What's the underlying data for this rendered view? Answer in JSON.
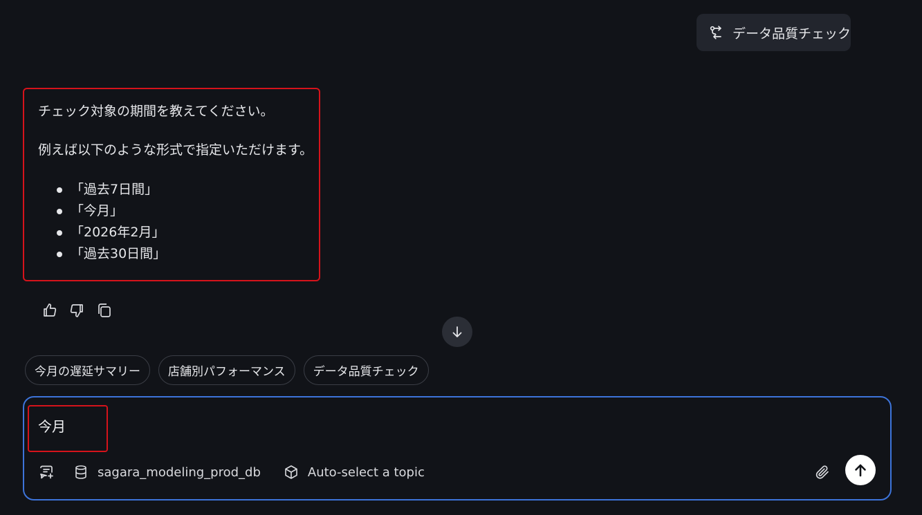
{
  "user_message": {
    "icon": "workflow-icon",
    "text": "データ品質チェック"
  },
  "assistant_message": {
    "paragraph1": "チェック対象の期間を教えてください。",
    "paragraph2": "例えば以下のような形式で指定いただけます。",
    "options": [
      "「過去7日間」",
      "「今月」",
      "「2026年2月」",
      "「過去30日間」"
    ]
  },
  "feedback": {
    "icons": [
      "thumbs-up-icon",
      "thumbs-down-icon",
      "copy-icon"
    ]
  },
  "scroll_button": {
    "icon": "arrow-down-icon"
  },
  "suggestions": [
    "今月の遅延サマリー",
    "店舗別パフォーマンス",
    "データ品質チェック"
  ],
  "composer": {
    "input_value": "今月",
    "database_label": "sagara_modeling_prod_db",
    "topic_label": "Auto-select a topic",
    "icons": [
      "new-chat-icon",
      "database-icon",
      "cube-icon",
      "paperclip-icon",
      "arrow-up-icon"
    ]
  },
  "colors": {
    "background": "#111318",
    "highlight_border": "#d6131b",
    "composer_border": "#3d74da",
    "send_button": "#ffffff"
  }
}
